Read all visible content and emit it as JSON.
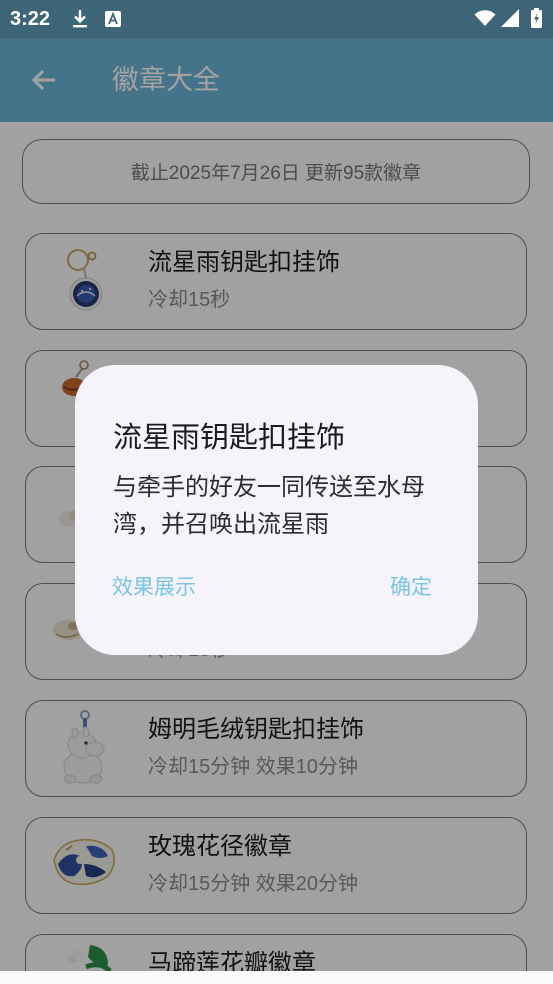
{
  "status_bar": {
    "time": "3:22",
    "icons": [
      "download-icon",
      "text-a-icon",
      "wifi-icon",
      "signal-icon",
      "battery-icon"
    ]
  },
  "app_bar": {
    "title": "徽章大全",
    "back_icon": "arrow-back-icon"
  },
  "banner": {
    "text": "截止2025年7月26日 更新95款徽章"
  },
  "badges": [
    {
      "title": "流星雨钥匙扣挂饰",
      "subtitle": "冷却15秒"
    },
    {},
    {},
    {
      "subtitle": "冷却15秒"
    },
    {
      "title": "姆明毛绒钥匙扣挂饰",
      "subtitle": "冷却15分钟 效果10分钟"
    },
    {
      "title": "玫瑰花径徽章",
      "subtitle": "冷却15分钟 效果20分钟"
    },
    {
      "title": "马蹄莲花瓣徽章"
    }
  ],
  "dialog": {
    "title": "流星雨钥匙扣挂饰",
    "body": "与牵手的好友一同传送至水母湾，并召唤出流星雨",
    "secondary_button": "效果展示",
    "primary_button": "确定"
  },
  "colors": {
    "status_bar": "#3d6477",
    "app_bar": "#6cb4d8",
    "accent": "#7ac4e4",
    "dialog_surface": "#f6f3fb",
    "scrim": "rgba(0,0,0,0.36)"
  }
}
